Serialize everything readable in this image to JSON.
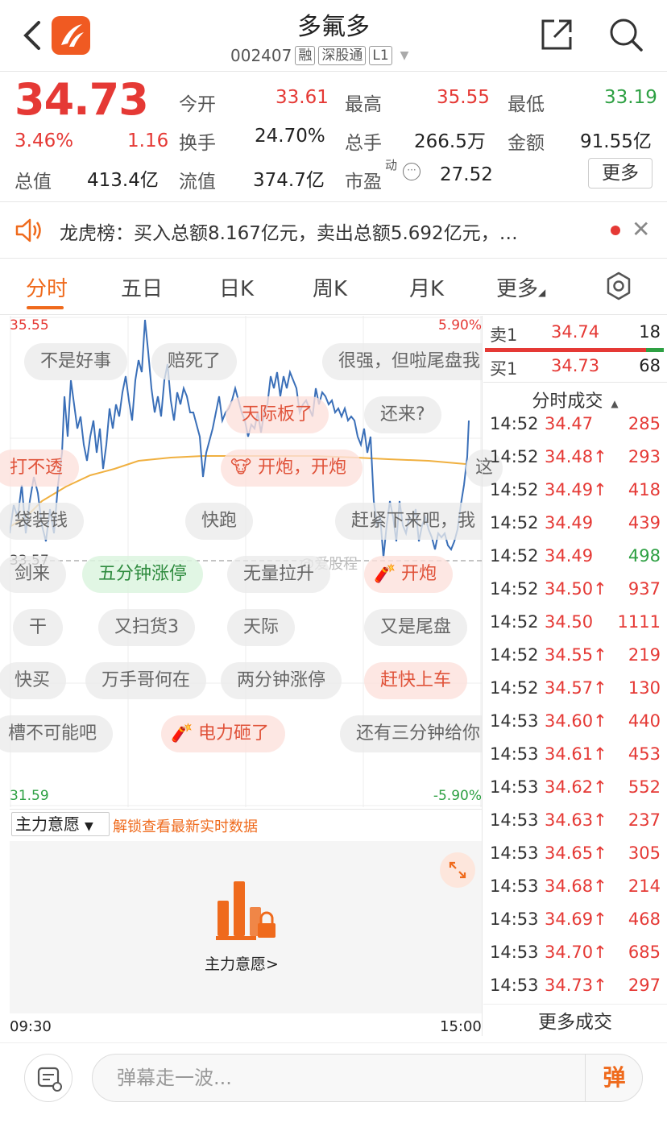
{
  "header": {
    "title": "多氟多",
    "code": "002407",
    "tags": [
      "融",
      "深股通",
      "L1"
    ]
  },
  "quote": {
    "price": "34.73",
    "change_pct": "3.46%",
    "change": "1.16",
    "fields": {
      "open_label": "今开",
      "open": "33.61",
      "high_label": "最高",
      "high": "35.55",
      "low_label": "最低",
      "low": "33.19",
      "turnover_label": "换手",
      "turnover": "24.70%",
      "volume_label": "总手",
      "volume": "266.5万",
      "amount_label": "金额",
      "amount": "91.55亿",
      "mktcap_label": "总值",
      "mktcap": "413.4亿",
      "float_label": "流值",
      "float": "374.7亿",
      "pe_label": "市盈",
      "pe_sup": "动",
      "pe": "27.52"
    },
    "more_label": "更多"
  },
  "notice": {
    "text": "龙虎榜：买入总额8.167亿元，卖出总额5.692亿元，…"
  },
  "tabs": [
    "分时",
    "五日",
    "日K",
    "周K",
    "月K",
    "更多"
  ],
  "active_tab": "分时",
  "chart": {
    "top_price": "35.55",
    "top_pct": "5.90%",
    "mid_price": "33.57",
    "bottom_price": "31.59",
    "bottom_pct": "-5.90%",
    "time_start": "09:30",
    "time_end": "15:00",
    "watermark": "@爱股程",
    "danmu": [
      {
        "text": "不是好事",
        "style": "gray"
      },
      {
        "text": "赔死了",
        "style": "gray"
      },
      {
        "text": "很强，但啦尾盘我",
        "style": "gray"
      },
      {
        "text": "天际板了",
        "style": "red"
      },
      {
        "text": "还来?",
        "style": "gray"
      },
      {
        "text": "打不透",
        "style": "red"
      },
      {
        "text": "开炮，开炮",
        "style": "red"
      },
      {
        "text": "这",
        "style": "gray"
      },
      {
        "text": "袋装钱",
        "style": "gray"
      },
      {
        "text": "快跑",
        "style": "gray"
      },
      {
        "text": "赶紧下来吧，我",
        "style": "gray"
      },
      {
        "text": "剑来",
        "style": "gray"
      },
      {
        "text": "五分钟涨停",
        "style": "green"
      },
      {
        "text": "无量拉升",
        "style": "gray"
      },
      {
        "text": "开炮",
        "style": "red"
      },
      {
        "text": "干",
        "style": "gray"
      },
      {
        "text": "又扫货3",
        "style": "gray"
      },
      {
        "text": "天际",
        "style": "gray"
      },
      {
        "text": "又是尾盘",
        "style": "gray"
      },
      {
        "text": "快买",
        "style": "gray"
      },
      {
        "text": "万手哥何在",
        "style": "gray"
      },
      {
        "text": "两分钟涨停",
        "style": "gray"
      },
      {
        "text": "赶快上车",
        "style": "red"
      },
      {
        "text": "槽不可能吧",
        "style": "gray"
      },
      {
        "text": "电力砸了",
        "style": "red"
      },
      {
        "text": "还有三分钟给你",
        "style": "gray"
      }
    ]
  },
  "zlyy": {
    "dropdown": "主力意愿",
    "unlock": "解锁查看最新实时数据",
    "caption": "主力意愿>"
  },
  "orderbook": {
    "ask": {
      "label": "卖1",
      "price": "34.74",
      "vol": "18"
    },
    "bid": {
      "label": "买1",
      "price": "34.73",
      "vol": "68"
    },
    "ask_ratio": 0.9
  },
  "trades_title": "分时成交",
  "trades": [
    {
      "time": "14:52",
      "price": "34.47",
      "vol": "285",
      "dir": "",
      "color": "red"
    },
    {
      "time": "14:52",
      "price": "34.48↑",
      "vol": "293",
      "dir": "up",
      "color": "red"
    },
    {
      "time": "14:52",
      "price": "34.49↑",
      "vol": "418",
      "dir": "up",
      "color": "red"
    },
    {
      "time": "14:52",
      "price": "34.49",
      "vol": "439",
      "dir": "",
      "color": "red"
    },
    {
      "time": "14:52",
      "price": "34.49",
      "vol": "498",
      "dir": "",
      "color": "green"
    },
    {
      "time": "14:52",
      "price": "34.50↑",
      "vol": "937",
      "dir": "up",
      "color": "red"
    },
    {
      "time": "14:52",
      "price": "34.50",
      "vol": "1111",
      "dir": "",
      "color": "red"
    },
    {
      "time": "14:52",
      "price": "34.55↑",
      "vol": "219",
      "dir": "up",
      "color": "red"
    },
    {
      "time": "14:52",
      "price": "34.57↑",
      "vol": "130",
      "dir": "up",
      "color": "red"
    },
    {
      "time": "14:53",
      "price": "34.60↑",
      "vol": "440",
      "dir": "up",
      "color": "red"
    },
    {
      "time": "14:53",
      "price": "34.61↑",
      "vol": "453",
      "dir": "up",
      "color": "red"
    },
    {
      "time": "14:53",
      "price": "34.62↑",
      "vol": "552",
      "dir": "up",
      "color": "red"
    },
    {
      "time": "14:53",
      "price": "34.63↑",
      "vol": "237",
      "dir": "up",
      "color": "red"
    },
    {
      "time": "14:53",
      "price": "34.65↑",
      "vol": "305",
      "dir": "up",
      "color": "red"
    },
    {
      "time": "14:53",
      "price": "34.68↑",
      "vol": "214",
      "dir": "up",
      "color": "red"
    },
    {
      "time": "14:53",
      "price": "34.69↑",
      "vol": "468",
      "dir": "up",
      "color": "red"
    },
    {
      "time": "14:53",
      "price": "34.70↑",
      "vol": "685",
      "dir": "up",
      "color": "red"
    },
    {
      "time": "14:53",
      "price": "34.73↑",
      "vol": "297",
      "dir": "up",
      "color": "red"
    }
  ],
  "more_trades": "更多成交",
  "danmu_input": {
    "placeholder": "弹幕走一波..."
  },
  "danmu_button": "弹",
  "colors": {
    "up": "#e53935",
    "down": "#2ea043",
    "accent": "#ef6a1c"
  }
}
